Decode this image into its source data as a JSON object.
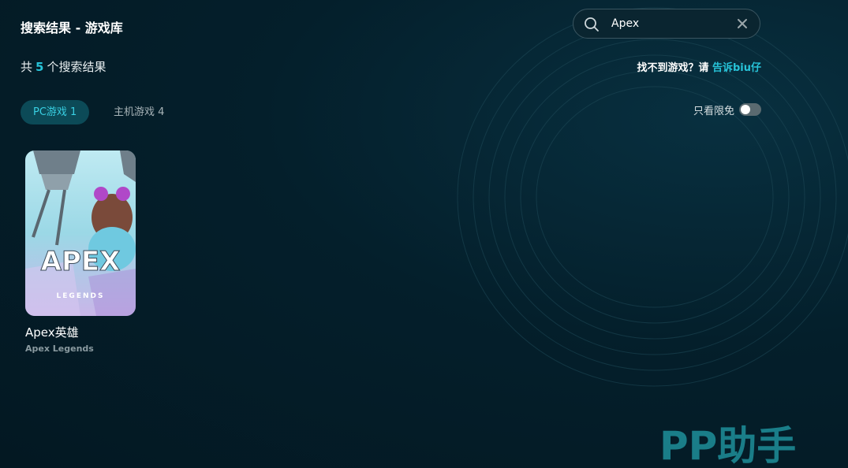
{
  "header": {
    "title": "搜索结果 - 游戏库"
  },
  "search": {
    "value": "Apex",
    "placeholder": ""
  },
  "results": {
    "prefix": "共",
    "count": "5",
    "suffix": "个搜索结果"
  },
  "notfound": {
    "text": "找不到游戏？请 ",
    "link": "告诉biu仔"
  },
  "tabs": [
    {
      "label": "PC游戏 1",
      "active": true
    },
    {
      "label": "主机游戏 4",
      "active": false
    }
  ],
  "filter": {
    "label": "只看限免",
    "on": false
  },
  "games": [
    {
      "name": "Apex英雄",
      "subtitle": "Apex Legends",
      "cover_title": "APEX",
      "cover_sub": "LEGENDS"
    }
  ],
  "brand": {
    "logo_text": "PP助手"
  },
  "colors": {
    "accent": "#27c3d8",
    "tab_active_bg": "#0c4a57",
    "background": "#041f2b"
  }
}
